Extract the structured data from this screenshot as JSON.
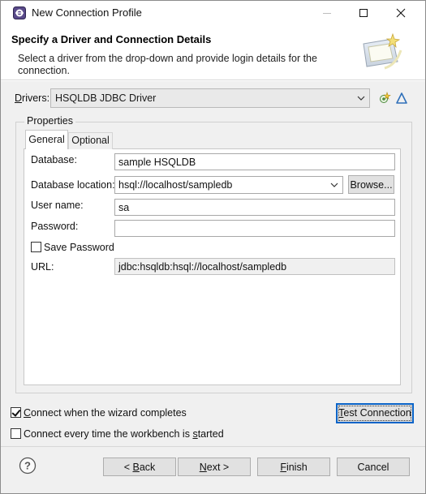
{
  "window": {
    "title": "New Connection Profile",
    "icons": {
      "app": "eclipse-icon",
      "minimize": "minimize-icon",
      "maximize": "maximize-icon",
      "close": "close-icon"
    }
  },
  "header": {
    "title": "Specify a Driver and Connection Details",
    "description": "Select a driver from the drop-down and provide login details for the connection.",
    "graphic": "wizard-banner-icon"
  },
  "drivers": {
    "label_underlined": "D",
    "label_rest": "rivers:",
    "selected": "HSQLDB JDBC Driver",
    "new_driver_icon": "new-driver-icon",
    "edit_driver_icon": "edit-driver-icon"
  },
  "properties": {
    "group_label": "Properties",
    "tabs": [
      {
        "label": "General",
        "active": true
      },
      {
        "label": "Optional",
        "active": false
      }
    ],
    "fields": {
      "database": {
        "label": "Database:",
        "value": "sample HSQLDB"
      },
      "database_location": {
        "label": "Database location:",
        "value": "hsql://localhost/sampledb",
        "browse_label": "Browse..."
      },
      "user_name": {
        "label": "User name:",
        "value": "sa"
      },
      "password": {
        "label": "Password:",
        "value": ""
      },
      "save_password": {
        "label": "Save Password",
        "checked": false
      },
      "url": {
        "label": "URL:",
        "value": "jdbc:hsqldb:hsql://localhost/sampledb"
      }
    }
  },
  "options": {
    "connect_on_complete": {
      "label_underlined": "C",
      "label_rest": "onnect when the wizard completes",
      "checked": true
    },
    "connect_every_time": {
      "label_before": "Connect every time the workbench is ",
      "label_underlined": "s",
      "label_after": "tarted",
      "checked": false
    },
    "test_connection": {
      "label_underlined": "T",
      "label_rest": "est Connection"
    }
  },
  "footer": {
    "help_icon": "help-icon",
    "back": {
      "before": "< ",
      "underlined": "B",
      "after": "ack"
    },
    "next": {
      "underlined": "N",
      "after": "ext >"
    },
    "finish": {
      "underlined": "F",
      "after": "inish"
    },
    "cancel": "Cancel"
  }
}
